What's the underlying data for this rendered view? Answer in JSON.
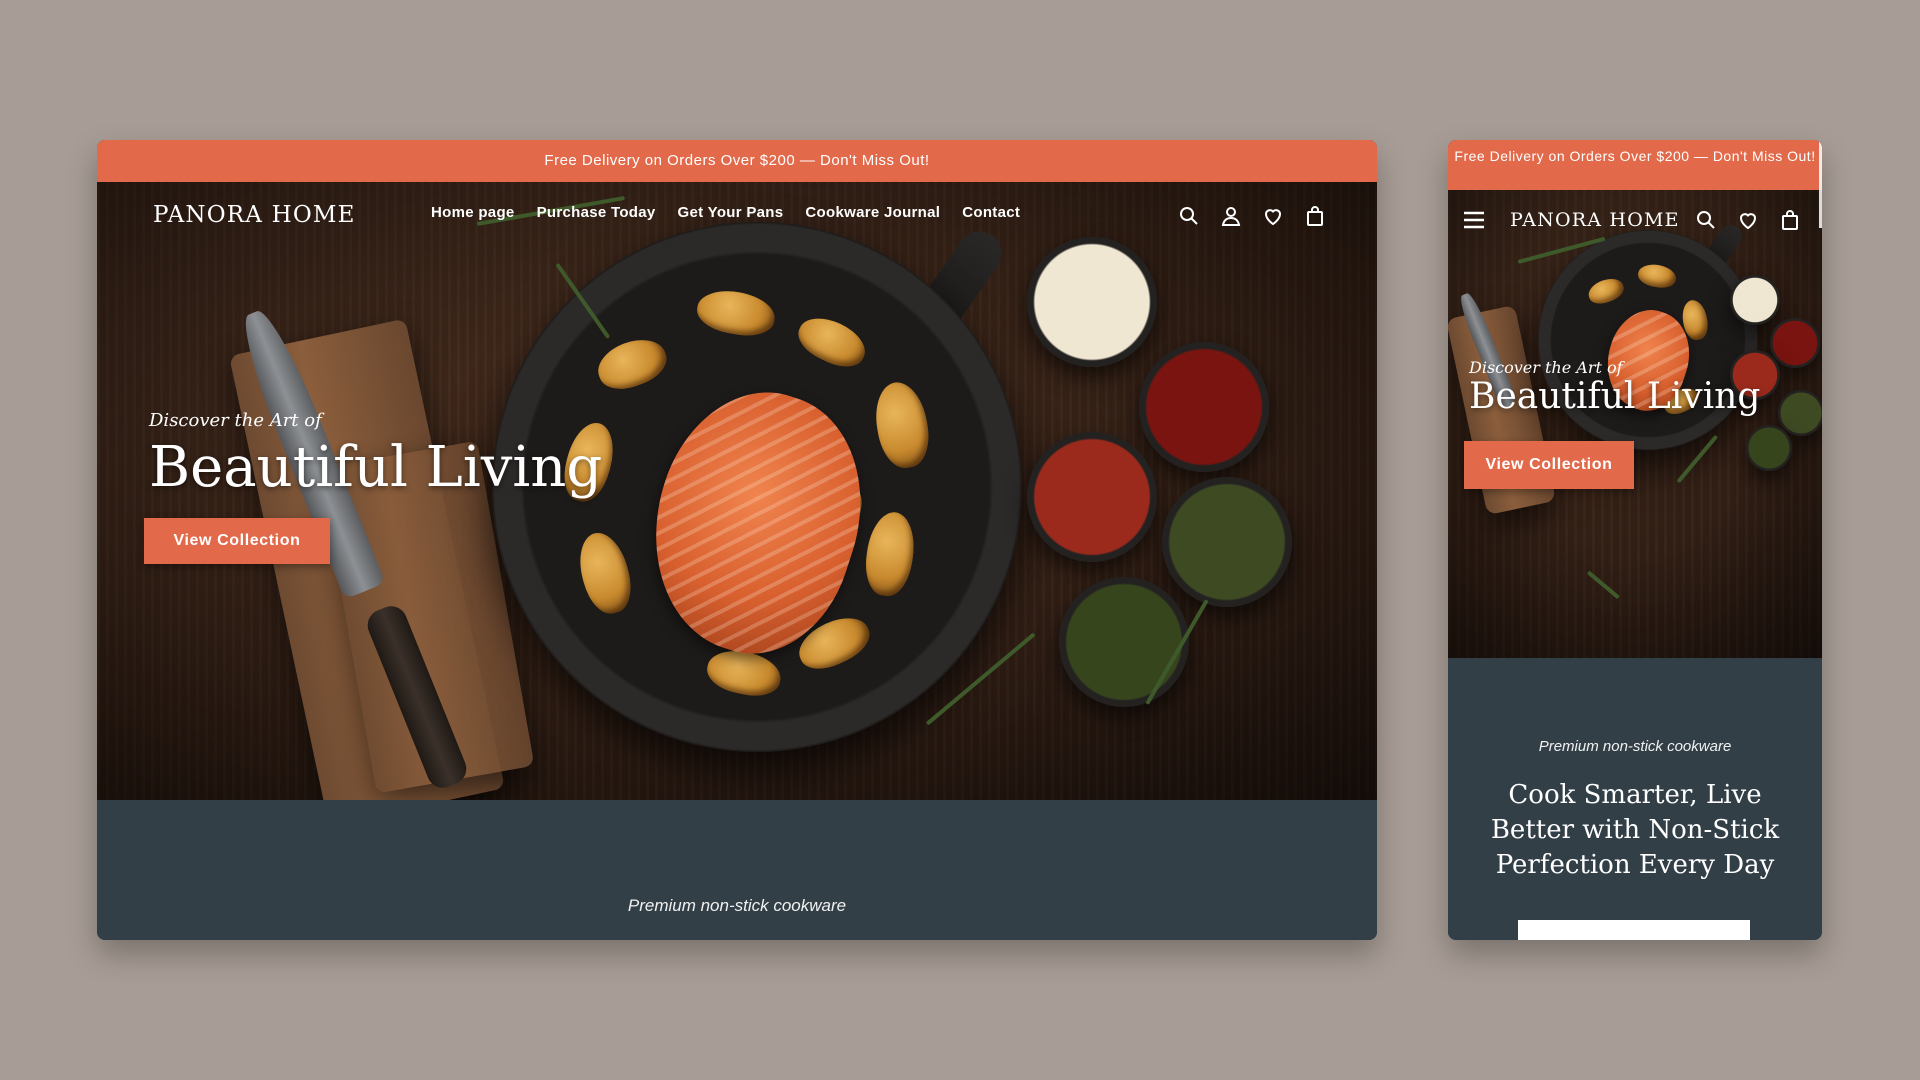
{
  "brand": {
    "logo": "PANORA HOME",
    "accent": "#e2694a",
    "dark_section": "#323f47"
  },
  "promo": {
    "text": "Free Delivery on Orders Over $200 — Don't Miss Out!"
  },
  "nav": {
    "items": [
      "Home page",
      "Purchase Today",
      "Get Your Pans",
      "Cookware Journal",
      "Contact"
    ]
  },
  "icons": [
    "search-icon",
    "account-icon",
    "heart-icon",
    "bag-icon",
    "menu-icon"
  ],
  "hero": {
    "eyebrow": "Discover the Art of",
    "headline": "Beautiful Living",
    "cta_label": "View Collection"
  },
  "section": {
    "tagline": "Premium non-stick cookware",
    "title": "Cook Smarter, Live Better with Non-Stick Perfection Every Day"
  }
}
